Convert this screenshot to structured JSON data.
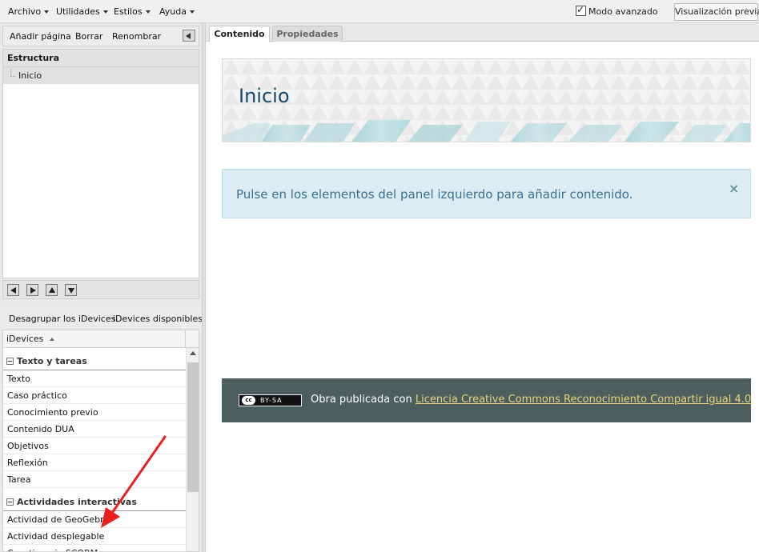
{
  "menubar": {
    "items": [
      "Archivo",
      "Utilidades",
      "Estilos",
      "Ayuda"
    ],
    "advanced_mode_label": "Modo avanzado",
    "advanced_mode_checked": true,
    "preview_button": "Visualización previa"
  },
  "left_panel": {
    "toolbar": {
      "add_page": "Añadir página",
      "delete": "Borrar",
      "rename": "Renombrar"
    },
    "structure": {
      "header": "Estructura",
      "nodes": [
        "Inicio"
      ]
    },
    "idevices_toolbar": {
      "ungroup": "Desagrupar los iDevices",
      "available": "iDevices disponibles"
    },
    "idevices": {
      "column_header": "iDevices",
      "categories": [
        {
          "name": "Texto y tareas",
          "items": [
            "Texto",
            "Caso práctico",
            "Conocimiento previo",
            "Contenido DUA",
            "Objetivos",
            "Reflexión",
            "Tarea"
          ]
        },
        {
          "name": "Actividades interactivas",
          "items": [
            "Actividad de GeoGebra",
            "Actividad desplegable",
            "Cuestionario SCORM"
          ]
        }
      ]
    }
  },
  "tabs": [
    "Contenido",
    "Propiedades"
  ],
  "content": {
    "page_title": "Inicio",
    "info_message": "Pulse en los elementos del panel izquierdo para añadir contenido.",
    "info_close": "×",
    "footer": {
      "badge_cc": "cc",
      "badge_text": "BY-SA",
      "prefix": "Obra publicada con ",
      "license_link": "Licencia Creative Commons Reconocimiento Compartir igual 4.0"
    }
  },
  "colors": {
    "title": "#16486b",
    "info_bg": "#dcecf3",
    "info_text": "#3b6e8f",
    "footer_bg": "#4d5e5e",
    "footer_link": "#e8d37a",
    "annotation_arrow": "#e8211e"
  }
}
